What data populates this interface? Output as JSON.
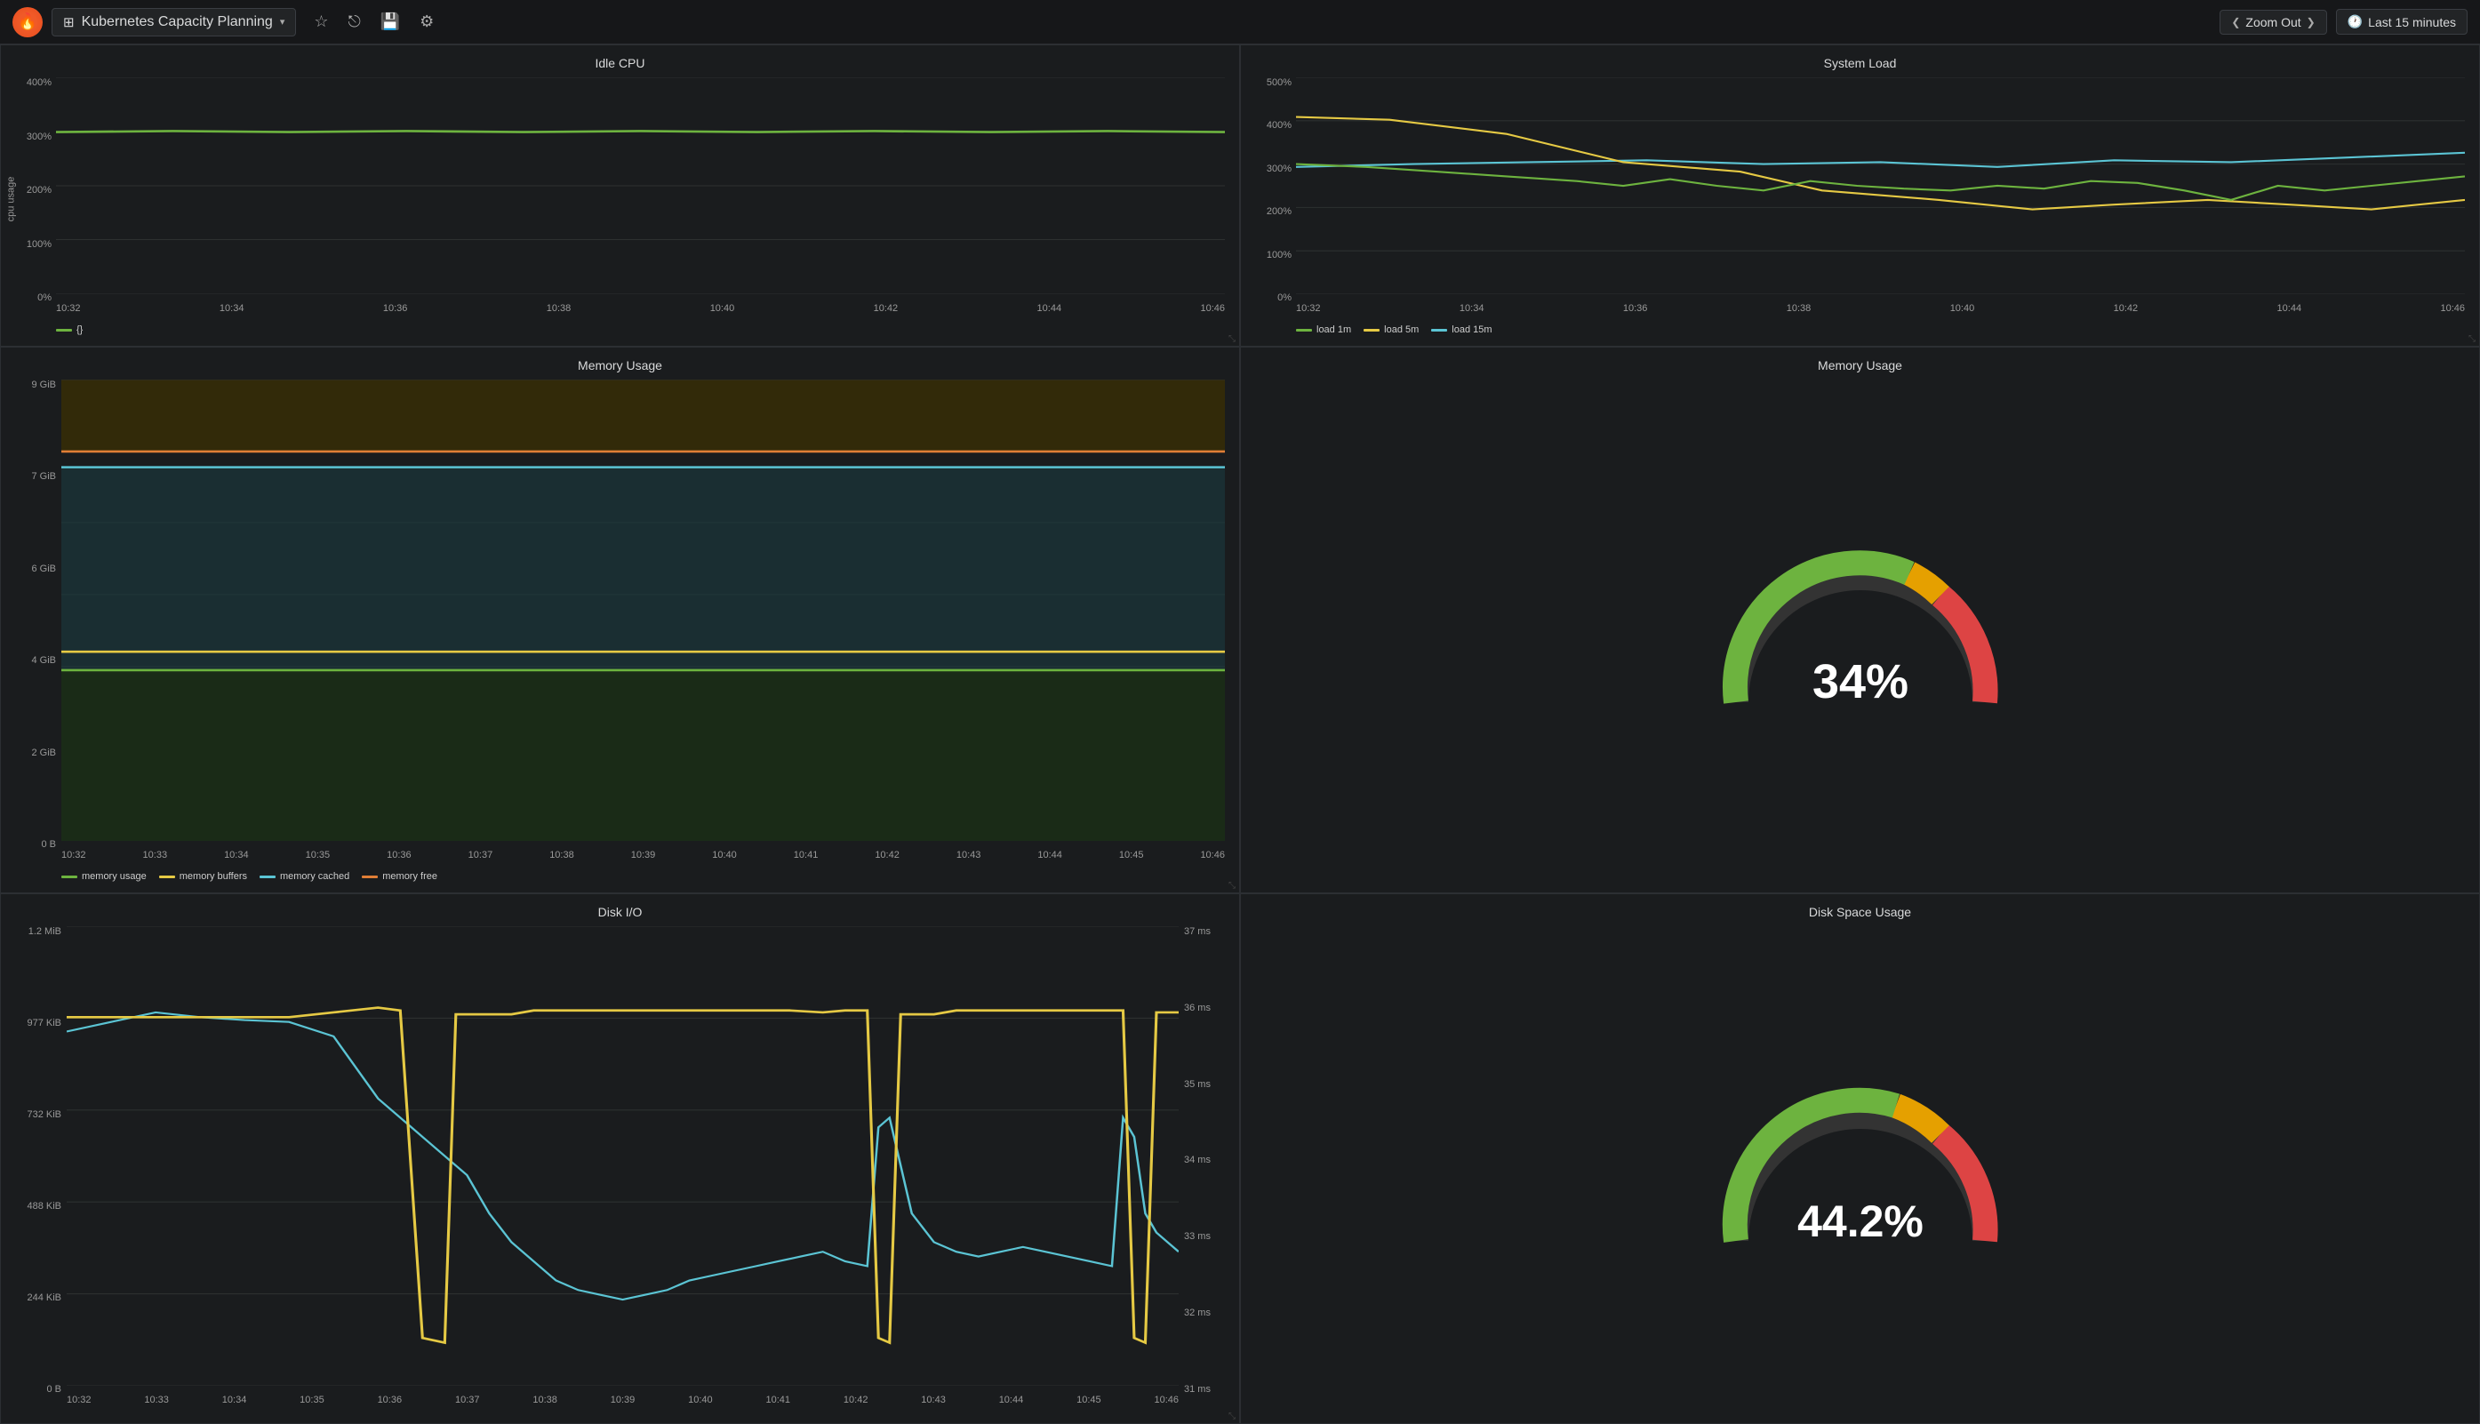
{
  "topnav": {
    "logo": "🔥",
    "title": "Kubernetes Capacity Planning",
    "title_icon": "⊞",
    "dropdown_arrow": "▾",
    "star_icon": "☆",
    "share_icon": "⎋",
    "save_icon": "💾",
    "settings_icon": "⚙",
    "zoom_out_label": "Zoom Out",
    "time_range_label": "Last 15 minutes",
    "nav_left": "❮",
    "nav_right": "❯",
    "clock_icon": "🕐"
  },
  "panels": {
    "idle_cpu": {
      "title": "Idle CPU",
      "y_labels": [
        "400%",
        "300%",
        "200%",
        "100%",
        "0%"
      ],
      "y_axis_label": "cpu usage",
      "x_labels": [
        "10:32",
        "10:34",
        "10:36",
        "10:38",
        "10:40",
        "10:42",
        "10:44",
        "10:46"
      ],
      "legend": [
        {
          "color": "#6db33f",
          "label": "{}"
        }
      ]
    },
    "system_load": {
      "title": "System Load",
      "y_labels": [
        "500%",
        "400%",
        "300%",
        "200%",
        "100%",
        "0%"
      ],
      "x_labels": [
        "10:32",
        "10:34",
        "10:36",
        "10:38",
        "10:40",
        "10:42",
        "10:44",
        "10:46"
      ],
      "legend": [
        {
          "color": "#6db33f",
          "label": "load 1m"
        },
        {
          "color": "#e5c944",
          "label": "load 5m"
        },
        {
          "color": "#5bc4d4",
          "label": "load 15m"
        }
      ]
    },
    "memory_usage_chart": {
      "title": "Memory Usage",
      "y_labels": [
        "9 GiB",
        "7 GiB",
        "6 GiB",
        "4 GiB",
        "2 GiB",
        "0 B"
      ],
      "x_labels": [
        "10:32",
        "10:33",
        "10:34",
        "10:35",
        "10:36",
        "10:37",
        "10:38",
        "10:39",
        "10:40",
        "10:41",
        "10:42",
        "10:43",
        "10:44",
        "10:45",
        "10:46"
      ],
      "legend": [
        {
          "color": "#6db33f",
          "label": "memory usage"
        },
        {
          "color": "#e5c944",
          "label": "memory buffers"
        },
        {
          "color": "#5bc4d4",
          "label": "memory cached"
        },
        {
          "color": "#e07e36",
          "label": "memory free"
        }
      ]
    },
    "memory_gauge": {
      "title": "Memory Usage",
      "value": "34%",
      "percent": 34
    },
    "disk_io": {
      "title": "Disk I/O",
      "y_labels_left": [
        "1.2 MiB",
        "977 KiB",
        "732 KiB",
        "488 KiB",
        "244 KiB",
        "0 B"
      ],
      "y_labels_right": [
        "37 ms",
        "36 ms",
        "35 ms",
        "34 ms",
        "33 ms",
        "32 ms",
        "31 ms"
      ],
      "x_labels": [
        "10:32",
        "10:33",
        "10:34",
        "10:35",
        "10:36",
        "10:37",
        "10:38",
        "10:39",
        "10:40",
        "10:41",
        "10:42",
        "10:43",
        "10:44",
        "10:45",
        "10:46"
      ]
    },
    "disk_gauge": {
      "title": "Disk Space Usage",
      "value": "44.2%",
      "percent": 44.2
    }
  }
}
